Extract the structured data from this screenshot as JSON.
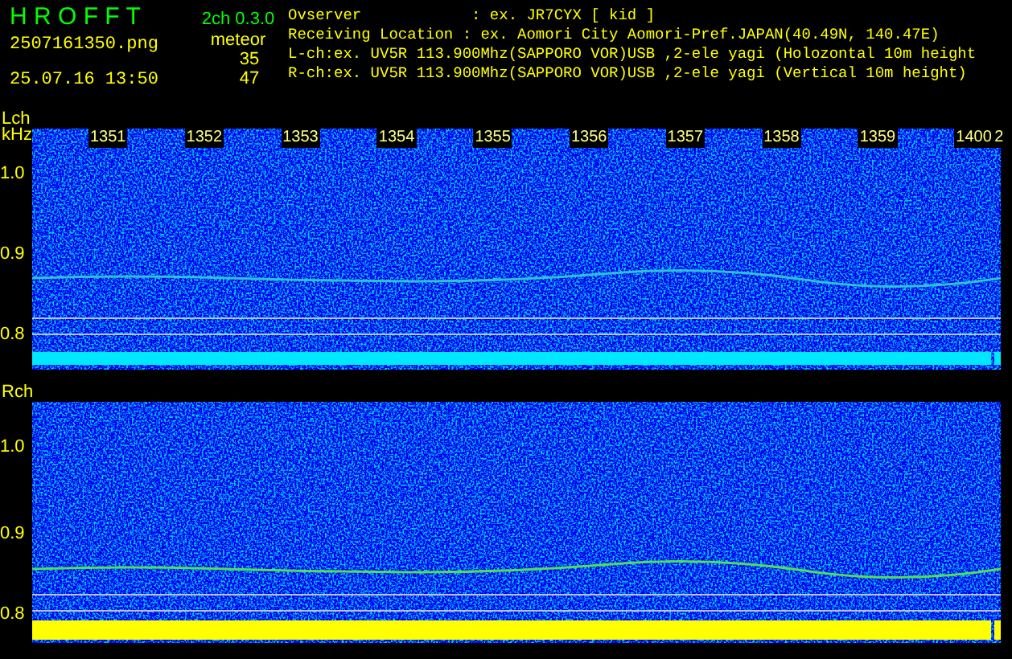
{
  "header": {
    "app_title": "H R O F F T",
    "version": "2ch 0.3.0",
    "filename": "2507161350.png",
    "datetime": "25.07.16 13:50",
    "count_label": "meteor",
    "counts": [
      "35",
      "47"
    ],
    "info_lines": [
      "Ovserver            : ex. JR7CYX [ kid ]",
      "Receiving Location : ex. Aomori City Aomori-Pref.JAPAN(40.49N, 140.47E)",
      "L-ch:ex. UV5R 113.900Mhz(SAPPORO VOR)USB ,2-ele yagi (Holozontal 10m height",
      "R-ch:ex. UV5R 113.900Mhz(SAPPORO VOR)USB ,2-ele yagi (Vertical 10m height)"
    ]
  },
  "channels": [
    {
      "label": "Lch",
      "unit": "kHz",
      "time_labels": [
        "1351",
        "1352",
        "1353",
        "1354",
        "1355",
        "1356",
        "1357",
        "1358",
        "1359",
        "1400",
        "2"
      ],
      "y_labels": [
        "1.0",
        "0.9",
        "0.8"
      ]
    },
    {
      "label": "Rch",
      "y_labels": [
        "1.0",
        "0.9",
        "0.8"
      ]
    }
  ]
}
